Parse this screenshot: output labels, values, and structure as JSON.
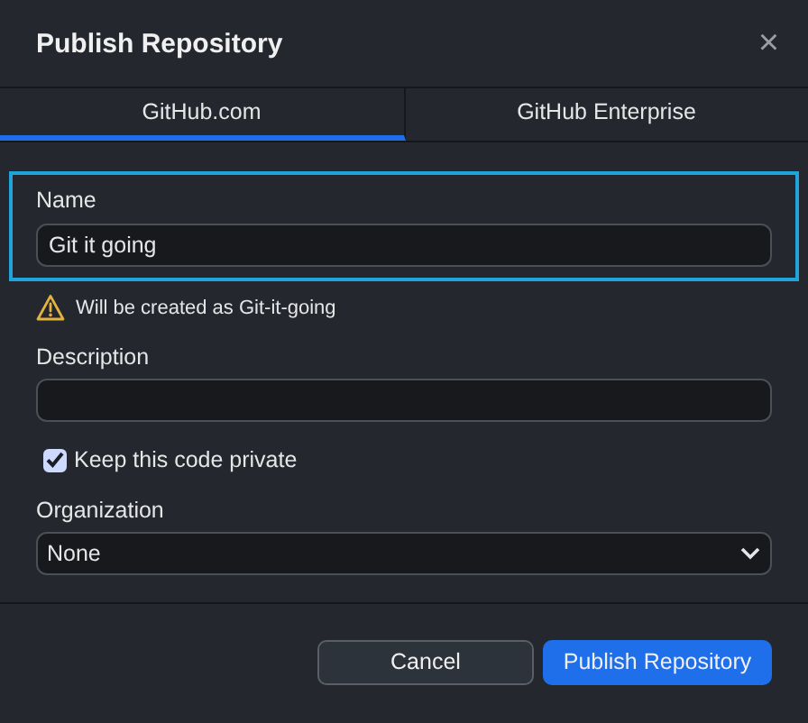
{
  "dialog": {
    "title": "Publish Repository",
    "close_symbol": "×"
  },
  "tabs": [
    {
      "label": "GitHub.com",
      "selected": true
    },
    {
      "label": "GitHub Enterprise",
      "selected": false
    }
  ],
  "name_section": {
    "highlighted": true,
    "label": "Name",
    "value": "Git it going",
    "warning": "Will be created as Git-it-going"
  },
  "description": {
    "label": "Description"
  },
  "private": {
    "label": "Keep this code private",
    "checked": true
  },
  "organization": {
    "label": "Organization",
    "value": "None"
  },
  "buttons": [
    {
      "label": "Cancel",
      "kind": "secondary"
    },
    {
      "label": "Publish Repository",
      "kind": "primary"
    }
  ]
}
